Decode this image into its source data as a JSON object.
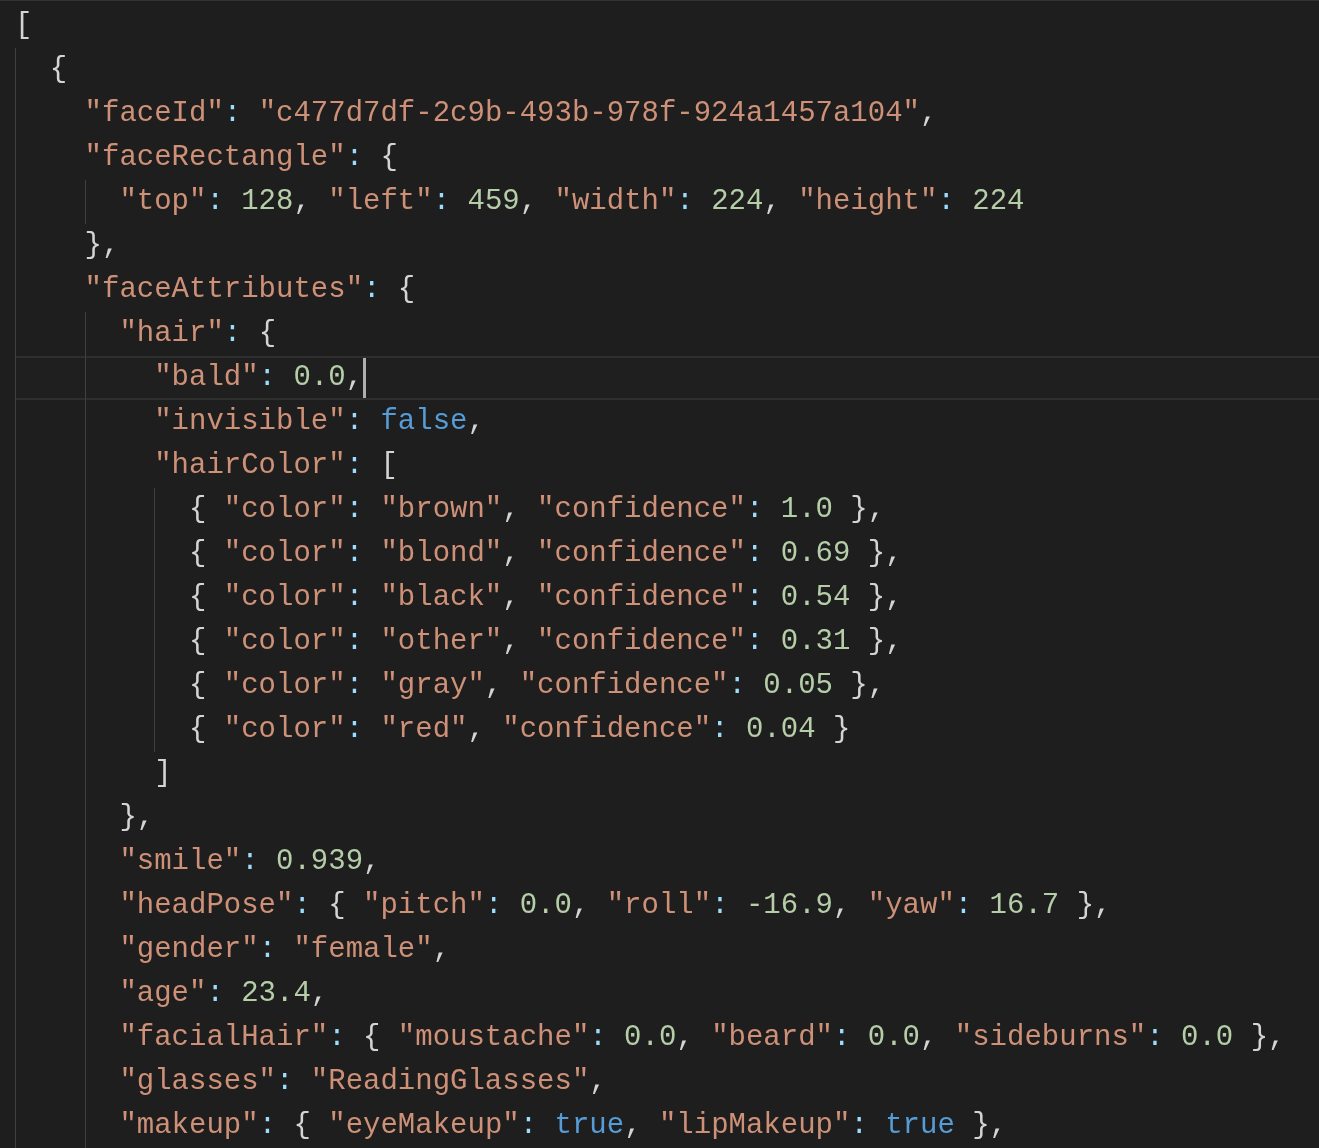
{
  "editor": {
    "lines": [
      {
        "current": false,
        "tokens": [
          {
            "kind": "punct",
            "text": "["
          }
        ],
        "children": [
          {
            "current": false,
            "tokens": [
              {
                "kind": "punct",
                "text": "{"
              }
            ],
            "children": [
              {
                "current": false,
                "tokens": [
                  {
                    "kind": "key",
                    "text": "\"faceId\""
                  },
                  {
                    "kind": "colon",
                    "text": ": "
                  },
                  {
                    "kind": "string",
                    "text": "\"c477d7df-2c9b-493b-978f-924a1457a104\""
                  },
                  {
                    "kind": "punct",
                    "text": ","
                  }
                ]
              },
              {
                "current": false,
                "tokens": [
                  {
                    "kind": "key",
                    "text": "\"faceRectangle\""
                  },
                  {
                    "kind": "colon",
                    "text": ": "
                  },
                  {
                    "kind": "punct",
                    "text": "{"
                  }
                ],
                "children": [
                  {
                    "current": false,
                    "tokens": [
                      {
                        "kind": "key",
                        "text": "\"top\""
                      },
                      {
                        "kind": "colon",
                        "text": ": "
                      },
                      {
                        "kind": "number",
                        "text": "128"
                      },
                      {
                        "kind": "punct",
                        "text": ", "
                      },
                      {
                        "kind": "key",
                        "text": "\"left\""
                      },
                      {
                        "kind": "colon",
                        "text": ": "
                      },
                      {
                        "kind": "number",
                        "text": "459"
                      },
                      {
                        "kind": "punct",
                        "text": ", "
                      },
                      {
                        "kind": "key",
                        "text": "\"width\""
                      },
                      {
                        "kind": "colon",
                        "text": ": "
                      },
                      {
                        "kind": "number",
                        "text": "224"
                      },
                      {
                        "kind": "punct",
                        "text": ", "
                      },
                      {
                        "kind": "key",
                        "text": "\"height\""
                      },
                      {
                        "kind": "colon",
                        "text": ": "
                      },
                      {
                        "kind": "number",
                        "text": "224"
                      }
                    ]
                  }
                ]
              },
              {
                "current": false,
                "tokens": [
                  {
                    "kind": "punct",
                    "text": "},"
                  }
                ]
              },
              {
                "current": false,
                "tokens": [
                  {
                    "kind": "key",
                    "text": "\"faceAttributes\""
                  },
                  {
                    "kind": "colon",
                    "text": ": "
                  },
                  {
                    "kind": "punct",
                    "text": "{"
                  }
                ],
                "children": [
                  {
                    "current": false,
                    "tokens": [
                      {
                        "kind": "key",
                        "text": "\"hair\""
                      },
                      {
                        "kind": "colon",
                        "text": ": "
                      },
                      {
                        "kind": "punct",
                        "text": "{"
                      }
                    ],
                    "children": [
                      {
                        "current": true,
                        "tokens": [
                          {
                            "kind": "key",
                            "text": "\"bald\""
                          },
                          {
                            "kind": "colon",
                            "text": ": "
                          },
                          {
                            "kind": "number",
                            "text": "0.0"
                          },
                          {
                            "kind": "punct",
                            "text": ","
                          }
                        ]
                      },
                      {
                        "current": false,
                        "tokens": [
                          {
                            "kind": "key",
                            "text": "\"invisible\""
                          },
                          {
                            "kind": "colon",
                            "text": ": "
                          },
                          {
                            "kind": "bool",
                            "text": "false"
                          },
                          {
                            "kind": "punct",
                            "text": ","
                          }
                        ]
                      },
                      {
                        "current": false,
                        "tokens": [
                          {
                            "kind": "key",
                            "text": "\"hairColor\""
                          },
                          {
                            "kind": "colon",
                            "text": ": "
                          },
                          {
                            "kind": "punct",
                            "text": "["
                          }
                        ],
                        "children": [
                          {
                            "current": false,
                            "tokens": [
                              {
                                "kind": "punct",
                                "text": "{ "
                              },
                              {
                                "kind": "key",
                                "text": "\"color\""
                              },
                              {
                                "kind": "colon",
                                "text": ": "
                              },
                              {
                                "kind": "string",
                                "text": "\"brown\""
                              },
                              {
                                "kind": "punct",
                                "text": ", "
                              },
                              {
                                "kind": "key",
                                "text": "\"confidence\""
                              },
                              {
                                "kind": "colon",
                                "text": ": "
                              },
                              {
                                "kind": "number",
                                "text": "1.0"
                              },
                              {
                                "kind": "punct",
                                "text": " },"
                              }
                            ]
                          },
                          {
                            "current": false,
                            "tokens": [
                              {
                                "kind": "punct",
                                "text": "{ "
                              },
                              {
                                "kind": "key",
                                "text": "\"color\""
                              },
                              {
                                "kind": "colon",
                                "text": ": "
                              },
                              {
                                "kind": "string",
                                "text": "\"blond\""
                              },
                              {
                                "kind": "punct",
                                "text": ", "
                              },
                              {
                                "kind": "key",
                                "text": "\"confidence\""
                              },
                              {
                                "kind": "colon",
                                "text": ": "
                              },
                              {
                                "kind": "number",
                                "text": "0.69"
                              },
                              {
                                "kind": "punct",
                                "text": " },"
                              }
                            ]
                          },
                          {
                            "current": false,
                            "tokens": [
                              {
                                "kind": "punct",
                                "text": "{ "
                              },
                              {
                                "kind": "key",
                                "text": "\"color\""
                              },
                              {
                                "kind": "colon",
                                "text": ": "
                              },
                              {
                                "kind": "string",
                                "text": "\"black\""
                              },
                              {
                                "kind": "punct",
                                "text": ", "
                              },
                              {
                                "kind": "key",
                                "text": "\"confidence\""
                              },
                              {
                                "kind": "colon",
                                "text": ": "
                              },
                              {
                                "kind": "number",
                                "text": "0.54"
                              },
                              {
                                "kind": "punct",
                                "text": " },"
                              }
                            ]
                          },
                          {
                            "current": false,
                            "tokens": [
                              {
                                "kind": "punct",
                                "text": "{ "
                              },
                              {
                                "kind": "key",
                                "text": "\"color\""
                              },
                              {
                                "kind": "colon",
                                "text": ": "
                              },
                              {
                                "kind": "string",
                                "text": "\"other\""
                              },
                              {
                                "kind": "punct",
                                "text": ", "
                              },
                              {
                                "kind": "key",
                                "text": "\"confidence\""
                              },
                              {
                                "kind": "colon",
                                "text": ": "
                              },
                              {
                                "kind": "number",
                                "text": "0.31"
                              },
                              {
                                "kind": "punct",
                                "text": " },"
                              }
                            ]
                          },
                          {
                            "current": false,
                            "tokens": [
                              {
                                "kind": "punct",
                                "text": "{ "
                              },
                              {
                                "kind": "key",
                                "text": "\"color\""
                              },
                              {
                                "kind": "colon",
                                "text": ": "
                              },
                              {
                                "kind": "string",
                                "text": "\"gray\""
                              },
                              {
                                "kind": "punct",
                                "text": ", "
                              },
                              {
                                "kind": "key",
                                "text": "\"confidence\""
                              },
                              {
                                "kind": "colon",
                                "text": ": "
                              },
                              {
                                "kind": "number",
                                "text": "0.05"
                              },
                              {
                                "kind": "punct",
                                "text": " },"
                              }
                            ]
                          },
                          {
                            "current": false,
                            "tokens": [
                              {
                                "kind": "punct",
                                "text": "{ "
                              },
                              {
                                "kind": "key",
                                "text": "\"color\""
                              },
                              {
                                "kind": "colon",
                                "text": ": "
                              },
                              {
                                "kind": "string",
                                "text": "\"red\""
                              },
                              {
                                "kind": "punct",
                                "text": ", "
                              },
                              {
                                "kind": "key",
                                "text": "\"confidence\""
                              },
                              {
                                "kind": "colon",
                                "text": ": "
                              },
                              {
                                "kind": "number",
                                "text": "0.04"
                              },
                              {
                                "kind": "punct",
                                "text": " }"
                              }
                            ]
                          }
                        ]
                      },
                      {
                        "current": false,
                        "tokens": [
                          {
                            "kind": "punct",
                            "text": "]"
                          }
                        ]
                      }
                    ]
                  },
                  {
                    "current": false,
                    "tokens": [
                      {
                        "kind": "punct",
                        "text": "},"
                      }
                    ]
                  },
                  {
                    "current": false,
                    "tokens": [
                      {
                        "kind": "key",
                        "text": "\"smile\""
                      },
                      {
                        "kind": "colon",
                        "text": ": "
                      },
                      {
                        "kind": "number",
                        "text": "0.939"
                      },
                      {
                        "kind": "punct",
                        "text": ","
                      }
                    ]
                  },
                  {
                    "current": false,
                    "tokens": [
                      {
                        "kind": "key",
                        "text": "\"headPose\""
                      },
                      {
                        "kind": "colon",
                        "text": ": "
                      },
                      {
                        "kind": "punct",
                        "text": "{ "
                      },
                      {
                        "kind": "key",
                        "text": "\"pitch\""
                      },
                      {
                        "kind": "colon",
                        "text": ": "
                      },
                      {
                        "kind": "number",
                        "text": "0.0"
                      },
                      {
                        "kind": "punct",
                        "text": ", "
                      },
                      {
                        "kind": "key",
                        "text": "\"roll\""
                      },
                      {
                        "kind": "colon",
                        "text": ": "
                      },
                      {
                        "kind": "number",
                        "text": "-16.9"
                      },
                      {
                        "kind": "punct",
                        "text": ", "
                      },
                      {
                        "kind": "key",
                        "text": "\"yaw\""
                      },
                      {
                        "kind": "colon",
                        "text": ": "
                      },
                      {
                        "kind": "number",
                        "text": "16.7"
                      },
                      {
                        "kind": "punct",
                        "text": " },"
                      }
                    ]
                  },
                  {
                    "current": false,
                    "tokens": [
                      {
                        "kind": "key",
                        "text": "\"gender\""
                      },
                      {
                        "kind": "colon",
                        "text": ": "
                      },
                      {
                        "kind": "string",
                        "text": "\"female\""
                      },
                      {
                        "kind": "punct",
                        "text": ","
                      }
                    ]
                  },
                  {
                    "current": false,
                    "tokens": [
                      {
                        "kind": "key",
                        "text": "\"age\""
                      },
                      {
                        "kind": "colon",
                        "text": ": "
                      },
                      {
                        "kind": "number",
                        "text": "23.4"
                      },
                      {
                        "kind": "punct",
                        "text": ","
                      }
                    ]
                  },
                  {
                    "current": false,
                    "tokens": [
                      {
                        "kind": "key",
                        "text": "\"facialHair\""
                      },
                      {
                        "kind": "colon",
                        "text": ": "
                      },
                      {
                        "kind": "punct",
                        "text": "{ "
                      },
                      {
                        "kind": "key",
                        "text": "\"moustache\""
                      },
                      {
                        "kind": "colon",
                        "text": ": "
                      },
                      {
                        "kind": "number",
                        "text": "0.0"
                      },
                      {
                        "kind": "punct",
                        "text": ", "
                      },
                      {
                        "kind": "key",
                        "text": "\"beard\""
                      },
                      {
                        "kind": "colon",
                        "text": ": "
                      },
                      {
                        "kind": "number",
                        "text": "0.0"
                      },
                      {
                        "kind": "punct",
                        "text": ", "
                      },
                      {
                        "kind": "key",
                        "text": "\"sideburns\""
                      },
                      {
                        "kind": "colon",
                        "text": ": "
                      },
                      {
                        "kind": "number",
                        "text": "0.0"
                      },
                      {
                        "kind": "punct",
                        "text": " },"
                      }
                    ]
                  },
                  {
                    "current": false,
                    "tokens": [
                      {
                        "kind": "key",
                        "text": "\"glasses\""
                      },
                      {
                        "kind": "colon",
                        "text": ": "
                      },
                      {
                        "kind": "string",
                        "text": "\"ReadingGlasses\""
                      },
                      {
                        "kind": "punct",
                        "text": ","
                      }
                    ]
                  },
                  {
                    "current": false,
                    "tokens": [
                      {
                        "kind": "key",
                        "text": "\"makeup\""
                      },
                      {
                        "kind": "colon",
                        "text": ": "
                      },
                      {
                        "kind": "punct",
                        "text": "{ "
                      },
                      {
                        "kind": "key",
                        "text": "\"eyeMakeup\""
                      },
                      {
                        "kind": "colon",
                        "text": ": "
                      },
                      {
                        "kind": "bool",
                        "text": "true"
                      },
                      {
                        "kind": "punct",
                        "text": ", "
                      },
                      {
                        "kind": "key",
                        "text": "\"lipMakeup\""
                      },
                      {
                        "kind": "colon",
                        "text": ": "
                      },
                      {
                        "kind": "bool",
                        "text": "true"
                      },
                      {
                        "kind": "punct",
                        "text": " },"
                      }
                    ]
                  }
                ]
              }
            ]
          }
        ]
      }
    ]
  }
}
